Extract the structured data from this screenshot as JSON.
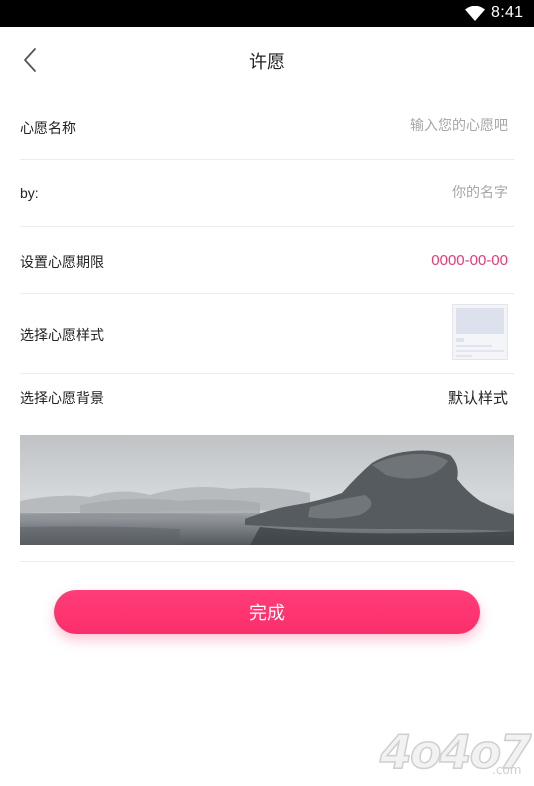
{
  "status_bar": {
    "time": "8:41",
    "icons": [
      "wifi-icon",
      "battery-icon"
    ]
  },
  "header": {
    "back_icon": "chevron-left-icon",
    "title": "许愿"
  },
  "form": {
    "wish_name": {
      "label": "心愿名称",
      "placeholder": "输入您的心愿吧",
      "value": ""
    },
    "author": {
      "label": "by:",
      "placeholder": "你的名字",
      "value": ""
    },
    "deadline": {
      "label": "设置心愿期限",
      "value": "0000-00-00"
    },
    "wish_style": {
      "label": "选择心愿样式",
      "thumbnail_icon": "card-template-icon"
    },
    "wish_background": {
      "label": "选择心愿背景",
      "value": "默认样式",
      "image": "foggy-lake-landscape"
    }
  },
  "actions": {
    "submit_label": "完成"
  },
  "watermark": {
    "text": "4o4o7",
    "domain": ".com"
  },
  "colors": {
    "accent": "#fb2e6a",
    "date_text": "#e23c77",
    "status_bar": "#000000",
    "divider": "#ececec",
    "placeholder": "#a6a6a6"
  }
}
